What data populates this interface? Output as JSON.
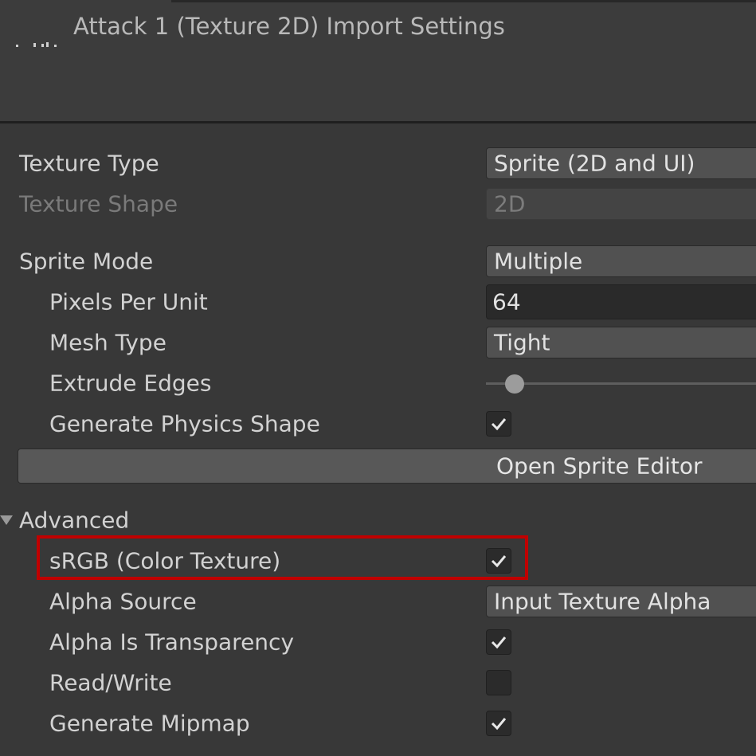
{
  "header": {
    "title": "Attack 1 (Texture 2D) Import Settings"
  },
  "settings": {
    "texture_type": {
      "label": "Texture Type",
      "value": "Sprite (2D and UI)"
    },
    "texture_shape": {
      "label": "Texture Shape",
      "value": "2D"
    },
    "sprite_mode": {
      "label": "Sprite Mode",
      "value": "Multiple"
    },
    "pixels_per_unit": {
      "label": "Pixels Per Unit",
      "value": "64"
    },
    "mesh_type": {
      "label": "Mesh Type",
      "value": "Tight"
    },
    "extrude_edges": {
      "label": "Extrude Edges",
      "value_fraction": 0.1
    },
    "generate_physics_shape": {
      "label": "Generate Physics Shape",
      "checked": true
    },
    "open_sprite_editor": {
      "label": "Open Sprite Editor"
    }
  },
  "advanced": {
    "label": "Advanced",
    "expanded": true,
    "srgb": {
      "label": "sRGB (Color Texture)",
      "checked": true,
      "highlighted": true
    },
    "alpha_source": {
      "label": "Alpha Source",
      "value": "Input Texture Alpha"
    },
    "alpha_is_transparency": {
      "label": "Alpha Is Transparency",
      "checked": true
    },
    "read_write": {
      "label": "Read/Write",
      "checked": false
    },
    "generate_mipmap": {
      "label": "Generate Mipmap",
      "checked": true
    }
  },
  "icons": {
    "header": "texture-asset-icon",
    "foldout": "triangle-down-icon",
    "check": "checkmark-icon"
  },
  "colors": {
    "highlight": "#c00000",
    "background": "#383838"
  }
}
